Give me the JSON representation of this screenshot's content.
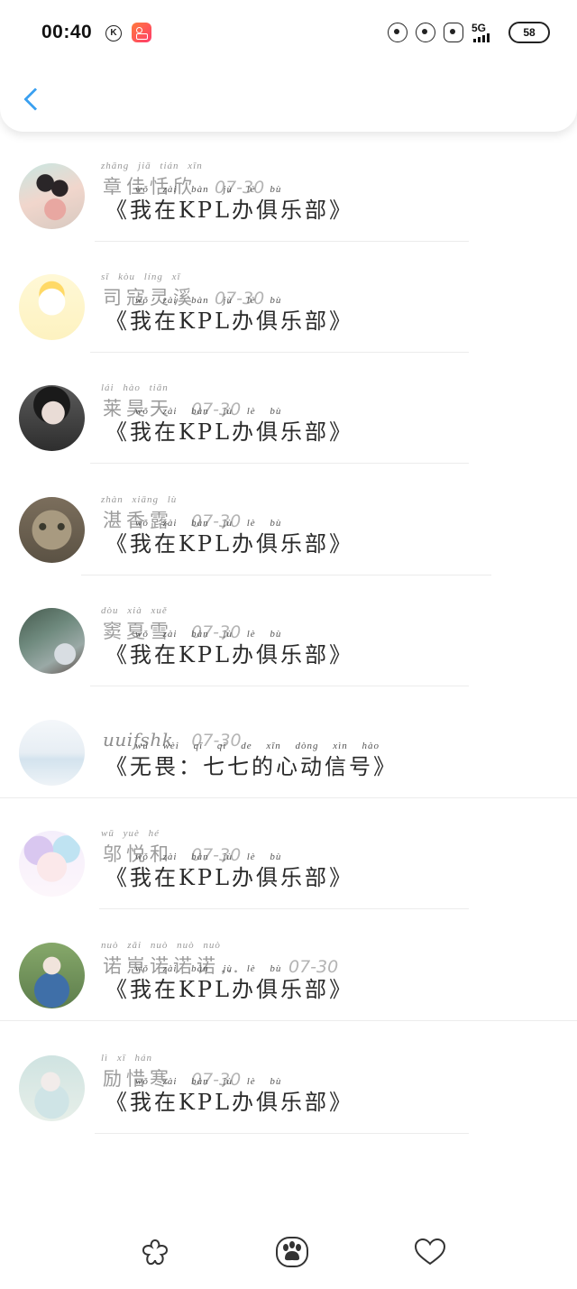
{
  "status_bar": {
    "time": "00:40",
    "k_icon_text": "K",
    "network": "5G",
    "battery": "58",
    "icons": [
      "cloud-icon",
      "pet-icon",
      "cat-icon"
    ]
  },
  "colors": {
    "accent": "#3aa0f0",
    "name_gray": "#9b9b9b",
    "date_gray": "#b4b4b4"
  },
  "list": {
    "items": [
      {
        "name": "",
        "name_pinyin": "",
        "date": "",
        "title": "《我在KPL办俱乐部》",
        "title_pinyin": "wǒ zài bàn jù lè bù"
      },
      {
        "name": "章佳恬欣",
        "name_pinyin": "zhāng jiā tián xīn",
        "date": "07-30",
        "title": "《我在KPL办俱乐部》",
        "title_pinyin": "wǒ zài bàn jù lè bù"
      },
      {
        "name": "司寇灵溪",
        "name_pinyin": "sī kòu líng xī",
        "date": "07-30",
        "title": "《我在KPL办俱乐部》",
        "title_pinyin": "wǒ zài bàn jù lè bù"
      },
      {
        "name": "莱昊天",
        "name_pinyin": "lái hào tiān",
        "date": "07-30",
        "title": "《我在KPL办俱乐部》",
        "title_pinyin": "wǒ zài bàn jù lè bù"
      },
      {
        "name": "湛香露",
        "name_pinyin": "zhàn xiāng lù",
        "date": "07-30",
        "title": "《我在KPL办俱乐部》",
        "title_pinyin": "wǒ zài bàn jù lè bù"
      },
      {
        "name": "窦夏雪",
        "name_pinyin": "dòu xià xuě",
        "date": "07-30",
        "title": "《我在KPL办俱乐部》",
        "title_pinyin": "wǒ zài bàn jù lè bù"
      },
      {
        "name": "uuifshk",
        "name_pinyin": "",
        "date": "07-30",
        "title": "《无畏：七七的心动信号》",
        "title_pinyin": "wú wèi qī qī de xīn dòng xìn hào"
      },
      {
        "name": "邬悦和",
        "name_pinyin": "wū yuè hé",
        "date": "07-30",
        "title": "《我在KPL办俱乐部》",
        "title_pinyin": "wǒ zài bàn jù lè bù"
      },
      {
        "name": "诺崽诺诺诺…",
        "name_pinyin": "nuò zǎi nuò nuò nuò",
        "date": "07-30",
        "title": "《我在KPL办俱乐部》",
        "title_pinyin": "wǒ zài bàn jù lè bù"
      },
      {
        "name": "励惜寒",
        "name_pinyin": "lì xī hán",
        "date": "07-30",
        "title": "《我在KPL办俱乐部》",
        "title_pinyin": "wǒ zài bàn jù lè bù"
      }
    ]
  },
  "tab_bar": {
    "icons": [
      "flower-icon",
      "paw-icon",
      "heart-icon"
    ]
  }
}
